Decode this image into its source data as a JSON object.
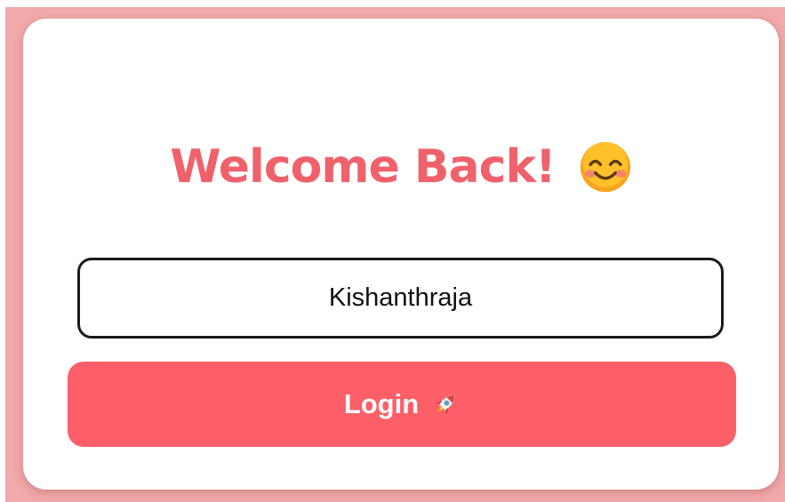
{
  "login_card": {
    "title": "Welcome Back!",
    "title_emoji": "smiling-face-icon",
    "username_field": {
      "value": "Kishanthraja"
    },
    "login_button": {
      "label": "Login",
      "icon": "rocket-icon"
    }
  },
  "colors": {
    "page_background": "#f1a9a9",
    "card_background": "#ffffff",
    "title": "#f0626b",
    "button": "#fd5f69",
    "button_text": "#ffffff",
    "input_border": "#1b1b1b"
  }
}
